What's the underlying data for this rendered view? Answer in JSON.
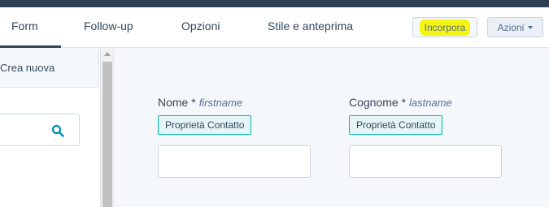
{
  "tabs": {
    "form": "Form",
    "follow_up": "Follow-up",
    "options": "Opzioni",
    "style": "Stile e anteprima"
  },
  "toolbar": {
    "embed_label": "Incorpora",
    "actions_label": "Azioni"
  },
  "sidebar": {
    "create_new_label": "Crea nuova",
    "search_icon": "search-icon"
  },
  "form_fields": [
    {
      "label": "Nome *",
      "internal_name": "firstname",
      "badge": "Proprietà Contatto",
      "value": ""
    },
    {
      "label": "Cognome *",
      "internal_name": "lastname",
      "badge": "Proprietà Contatto",
      "value": ""
    }
  ],
  "colors": {
    "topbar": "#2d3e50",
    "accent_teal": "#00bda5",
    "highlight": "#f5f515",
    "search_icon": "#0091ae"
  }
}
